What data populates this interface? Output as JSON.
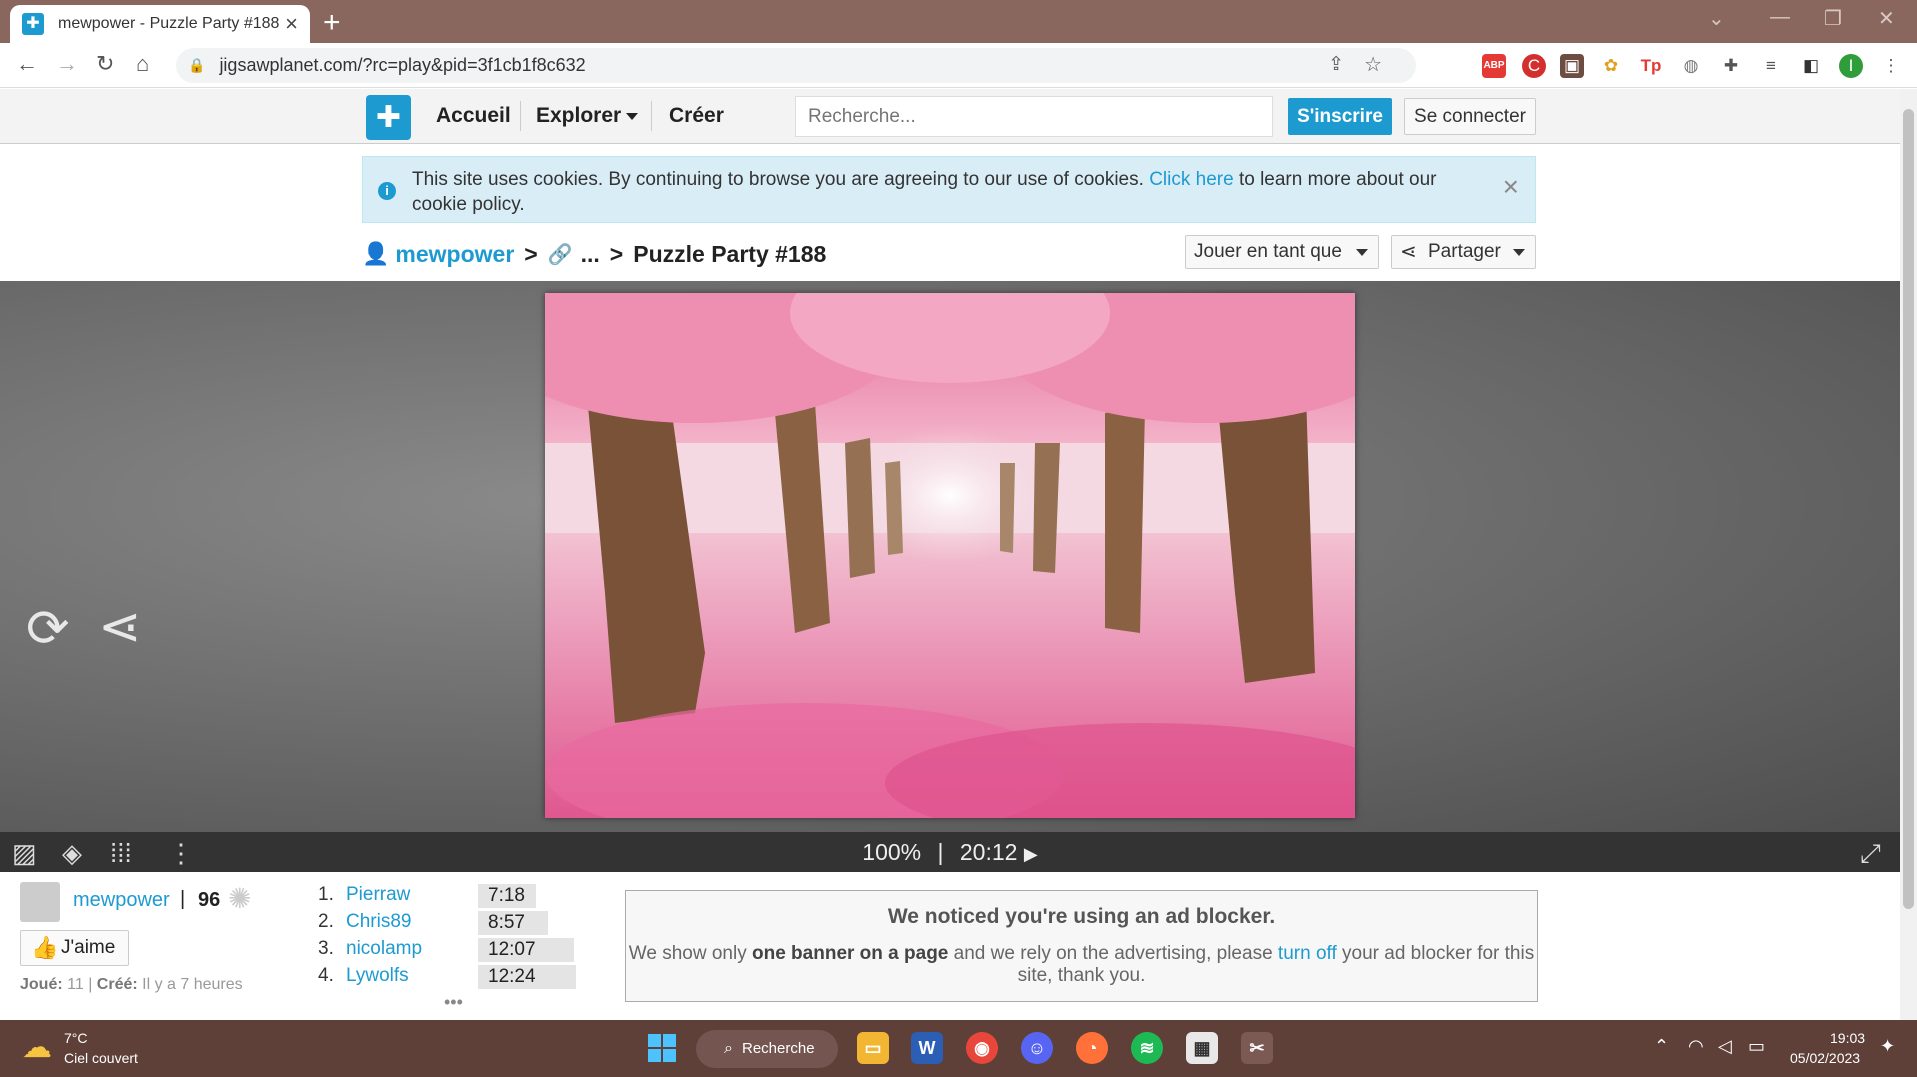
{
  "browser": {
    "tab_title": "mewpower - Puzzle Party #188",
    "url": "jigsawplanet.com/?rc=play&pid=3f1cb1f8c632",
    "profile_initial": "I"
  },
  "site_header": {
    "nav": [
      "Accueil",
      "Explorer",
      "Créer"
    ],
    "search_placeholder": "Recherche...",
    "signup_label": "S'inscrire",
    "login_label": "Se connecter"
  },
  "cookie_banner": {
    "text_before": "This site uses cookies. By continuing to browse you are agreeing to our use of cookies.",
    "link": "Click here",
    "text_after": "to learn more about our cookie policy."
  },
  "breadcrumb": {
    "user": "mewpower",
    "ellipsis": "...",
    "title": "Puzzle Party #188",
    "separator": ">"
  },
  "actions": {
    "play_as_label": "Jouer en tant que",
    "share_label": "Partager"
  },
  "controls": {
    "progress": "100%",
    "separator": "|",
    "timer": "20:12"
  },
  "owner": {
    "name": "mewpower",
    "score": "96",
    "separator": "|",
    "like_label": "J'aime",
    "played_label": "Joué:",
    "played_value": "11",
    "meta_separator": "|",
    "created_label": "Créé:",
    "created_value": "Il y a 7 heures"
  },
  "leaderboard": [
    {
      "rank": "1.",
      "name": "Pierraw",
      "time": "7:18"
    },
    {
      "rank": "2.",
      "name": "Chris89",
      "time": "8:57"
    },
    {
      "rank": "3.",
      "name": "nicolamp",
      "time": "12:07"
    },
    {
      "rank": "4.",
      "name": "Lywolfs",
      "time": "12:24"
    }
  ],
  "leaderboard_more": "•••",
  "adblock": {
    "title": "We noticed you're using an ad blocker.",
    "body_1": "We show only",
    "body_bold": "one banner on a page",
    "body_2": "and we rely on the advertising, please",
    "link": "turn off",
    "body_3": "your ad blocker for this site, thank you."
  },
  "taskbar": {
    "weather_temp": "7°C",
    "weather_desc": "Ciel couvert",
    "search_label": "Recherche",
    "time": "19:03",
    "date": "05/02/2023"
  },
  "colors": {
    "brand": "#1d9bd1",
    "tabbar": "#8a675e",
    "taskbar": "#5e4039"
  }
}
